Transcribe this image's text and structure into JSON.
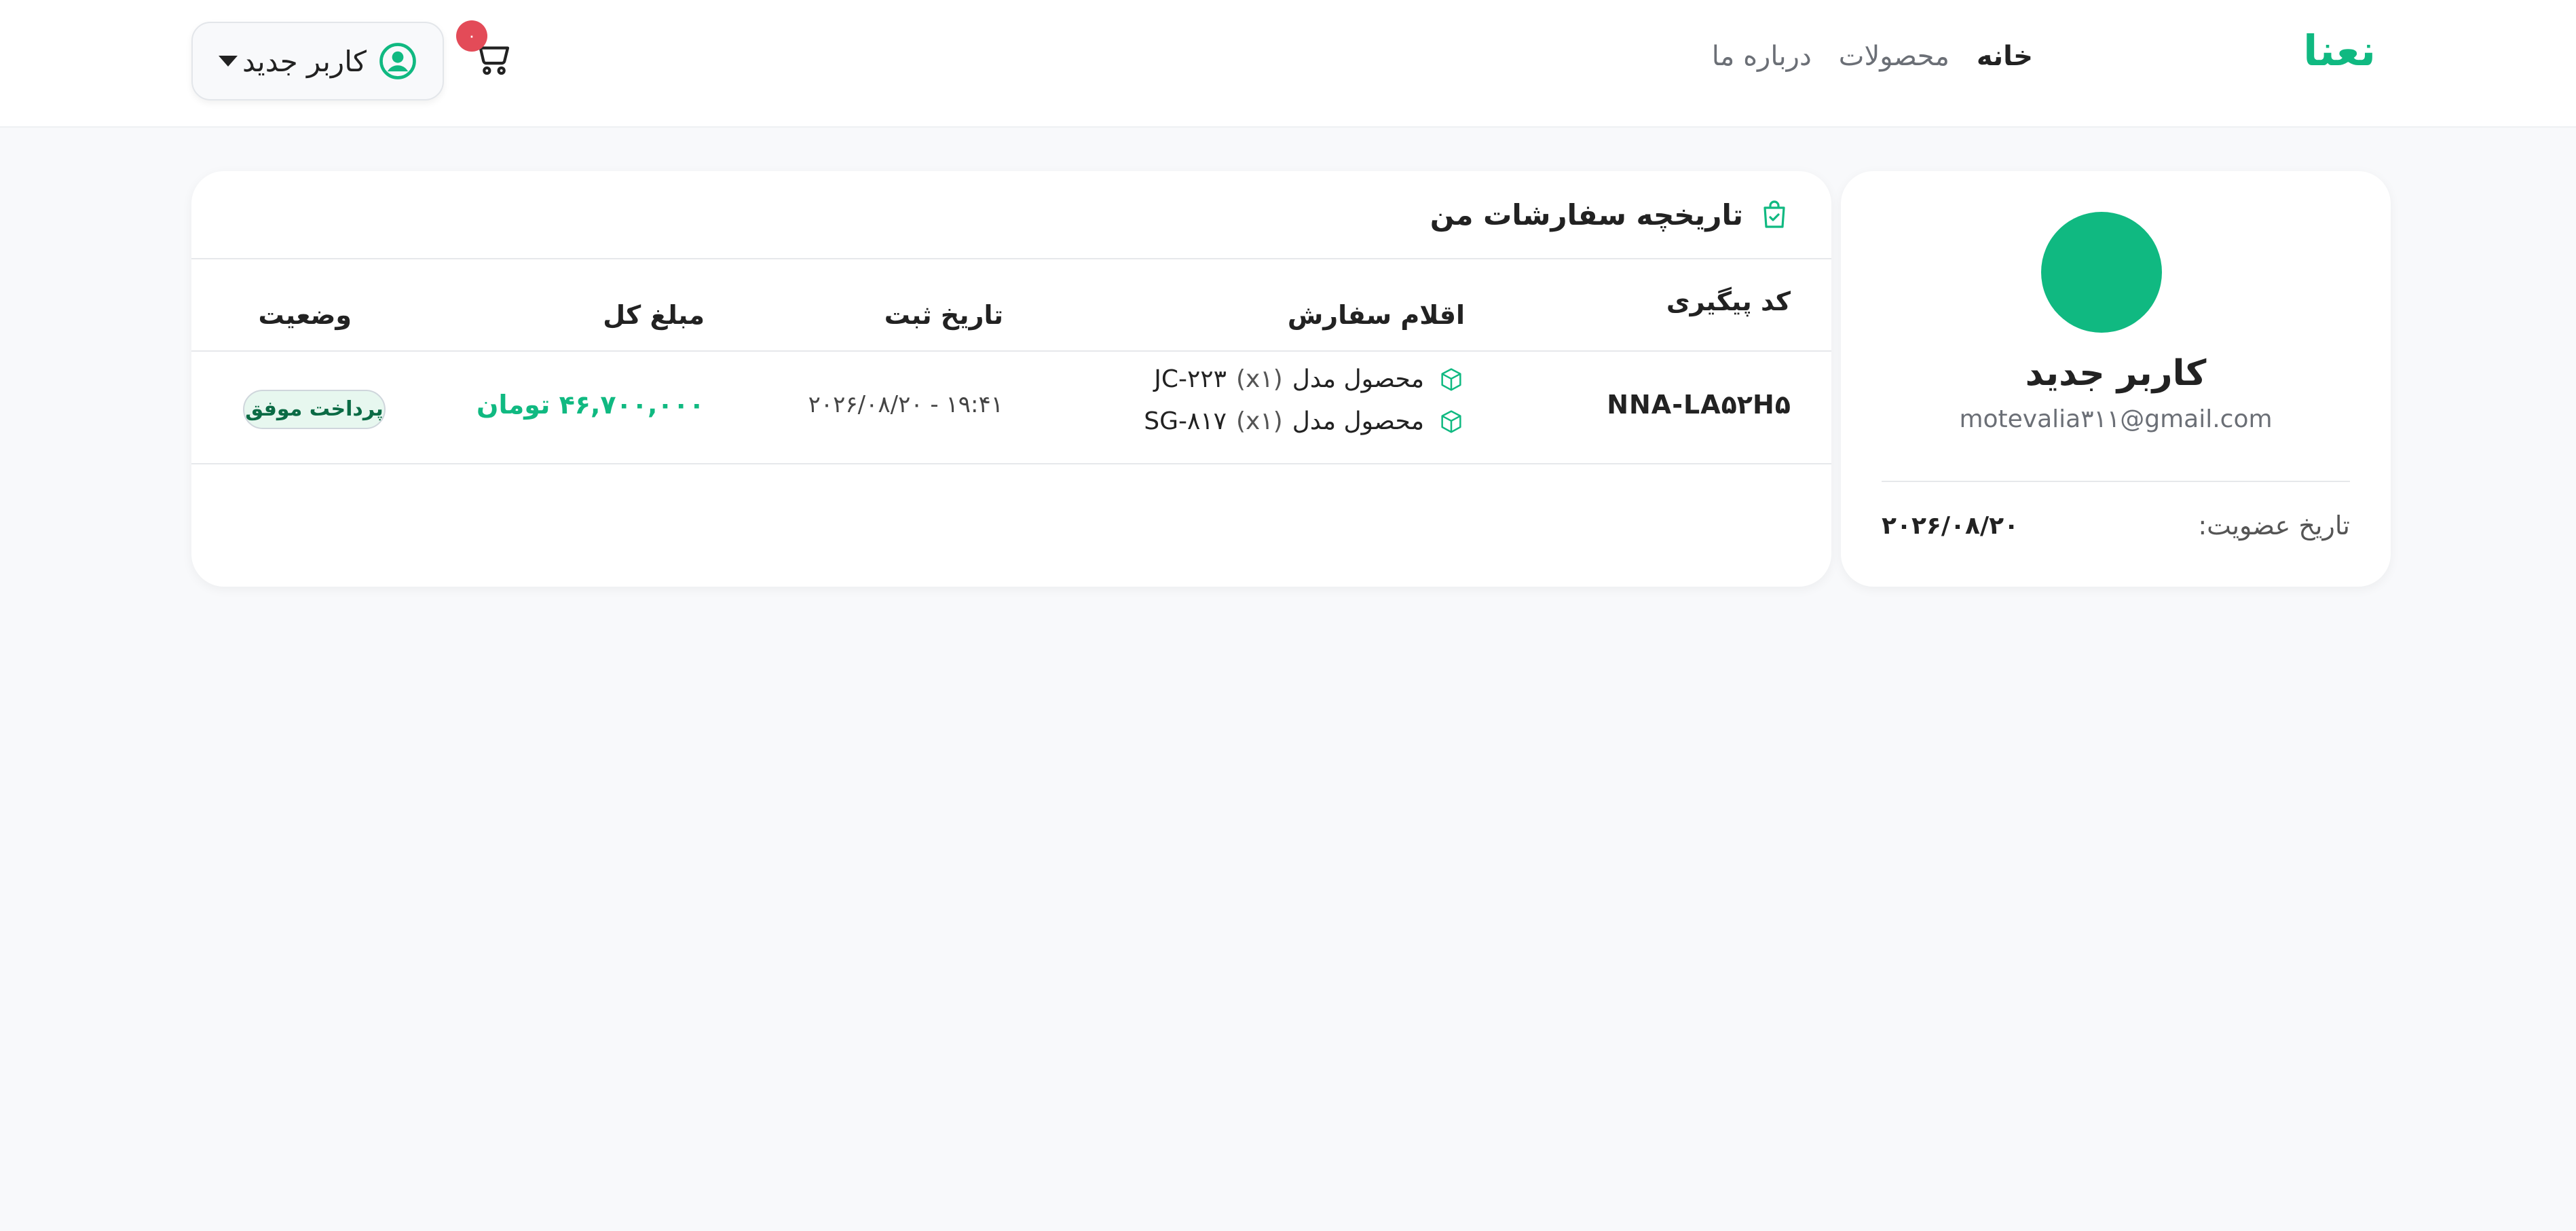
{
  "header": {
    "brand": "نعنا",
    "nav": {
      "home": "خانه",
      "products": "محصولات",
      "about": "درباره ما"
    },
    "user_name": "کاربر جدید",
    "cart_count": "۰"
  },
  "profile": {
    "name": "کاربر جدید",
    "email": "motevalia۳۱۱@gmail.com",
    "member_since_label": "تاریخ عضویت:",
    "member_since_value": "۲۰۲۶/۰۸/۲۰"
  },
  "orders": {
    "title": "تاریخچه سفارشات من",
    "columns": {
      "tracking": "کد پیگیری",
      "items": "اقلام سفارش",
      "date": "تاریخ ثبت",
      "amount": "مبلغ کل",
      "status": "وضعیت"
    },
    "rows": [
      {
        "tracking": "NNA-LA۵۲H۵",
        "items": [
          {
            "name": "محصول مدل",
            "qty": "(x۱)",
            "model": "JC-۲۲۳"
          },
          {
            "name": "محصول مدل",
            "qty": "(x۱)",
            "model": "SG-۸۱۷"
          }
        ],
        "date": "۲۰۲۶/۰۸/۲۰ - ۱۹:۴۱",
        "amount": "۴۶,۷۰۰,۰۰۰ تومان",
        "status": "پرداخت موفق"
      }
    ]
  },
  "colors": {
    "brand": "#10b981",
    "badge": "#e34b58"
  }
}
